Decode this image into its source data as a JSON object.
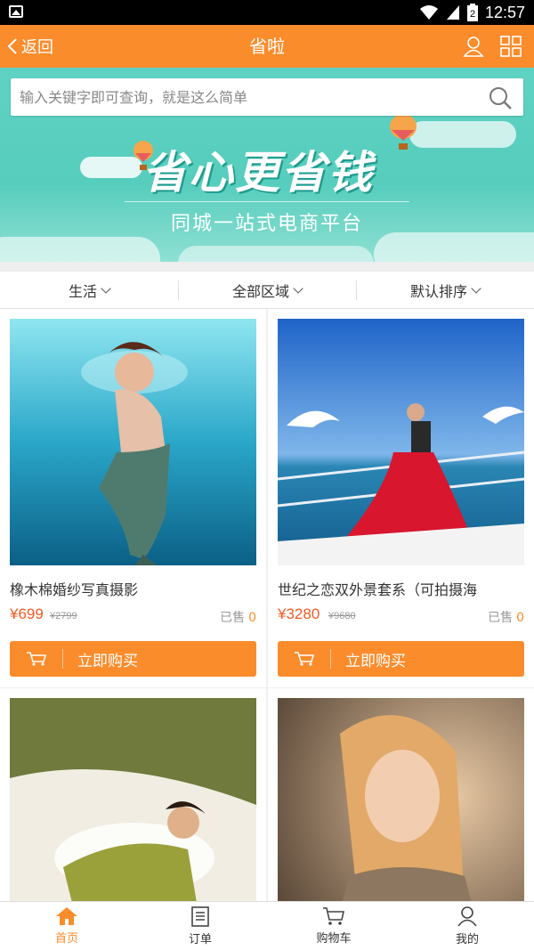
{
  "status_bar": {
    "time": "12:57",
    "battery_text": "2"
  },
  "header": {
    "back_label": "返回",
    "title": "省啦"
  },
  "search": {
    "placeholder": "输入关键字即可查询，就是这么简单"
  },
  "banner": {
    "slogan": "省心更省钱",
    "subtitle": "同城一站式电商平台"
  },
  "filters": [
    {
      "label": "生活"
    },
    {
      "label": "全部区域"
    },
    {
      "label": "默认排序"
    }
  ],
  "products": [
    {
      "name": "橡木棉婚纱写真摄影",
      "price": "¥699",
      "old_price": "¥2799",
      "sold_label": "已售",
      "sold_count": "0",
      "buy_label": "立即购买"
    },
    {
      "name": "世纪之恋双外景套系（可拍摄海",
      "price": "¥3280",
      "old_price": "¥9680",
      "sold_label": "已售",
      "sold_count": "0",
      "buy_label": "立即购买"
    },
    {
      "name": "",
      "price": "",
      "old_price": "",
      "sold_label": "",
      "sold_count": "",
      "buy_label": ""
    },
    {
      "name": "",
      "price": "",
      "old_price": "",
      "sold_label": "",
      "sold_count": "",
      "buy_label": ""
    }
  ],
  "bottom_nav": [
    {
      "label": "首页",
      "icon": "home-icon",
      "active": true
    },
    {
      "label": "订单",
      "icon": "order-icon",
      "active": false
    },
    {
      "label": "购物车",
      "icon": "cart-icon",
      "active": false
    },
    {
      "label": "我的",
      "icon": "user-icon",
      "active": false
    }
  ],
  "colors": {
    "accent": "#fb8c2c",
    "price": "#f15a24",
    "banner": "#5fd2c3"
  }
}
